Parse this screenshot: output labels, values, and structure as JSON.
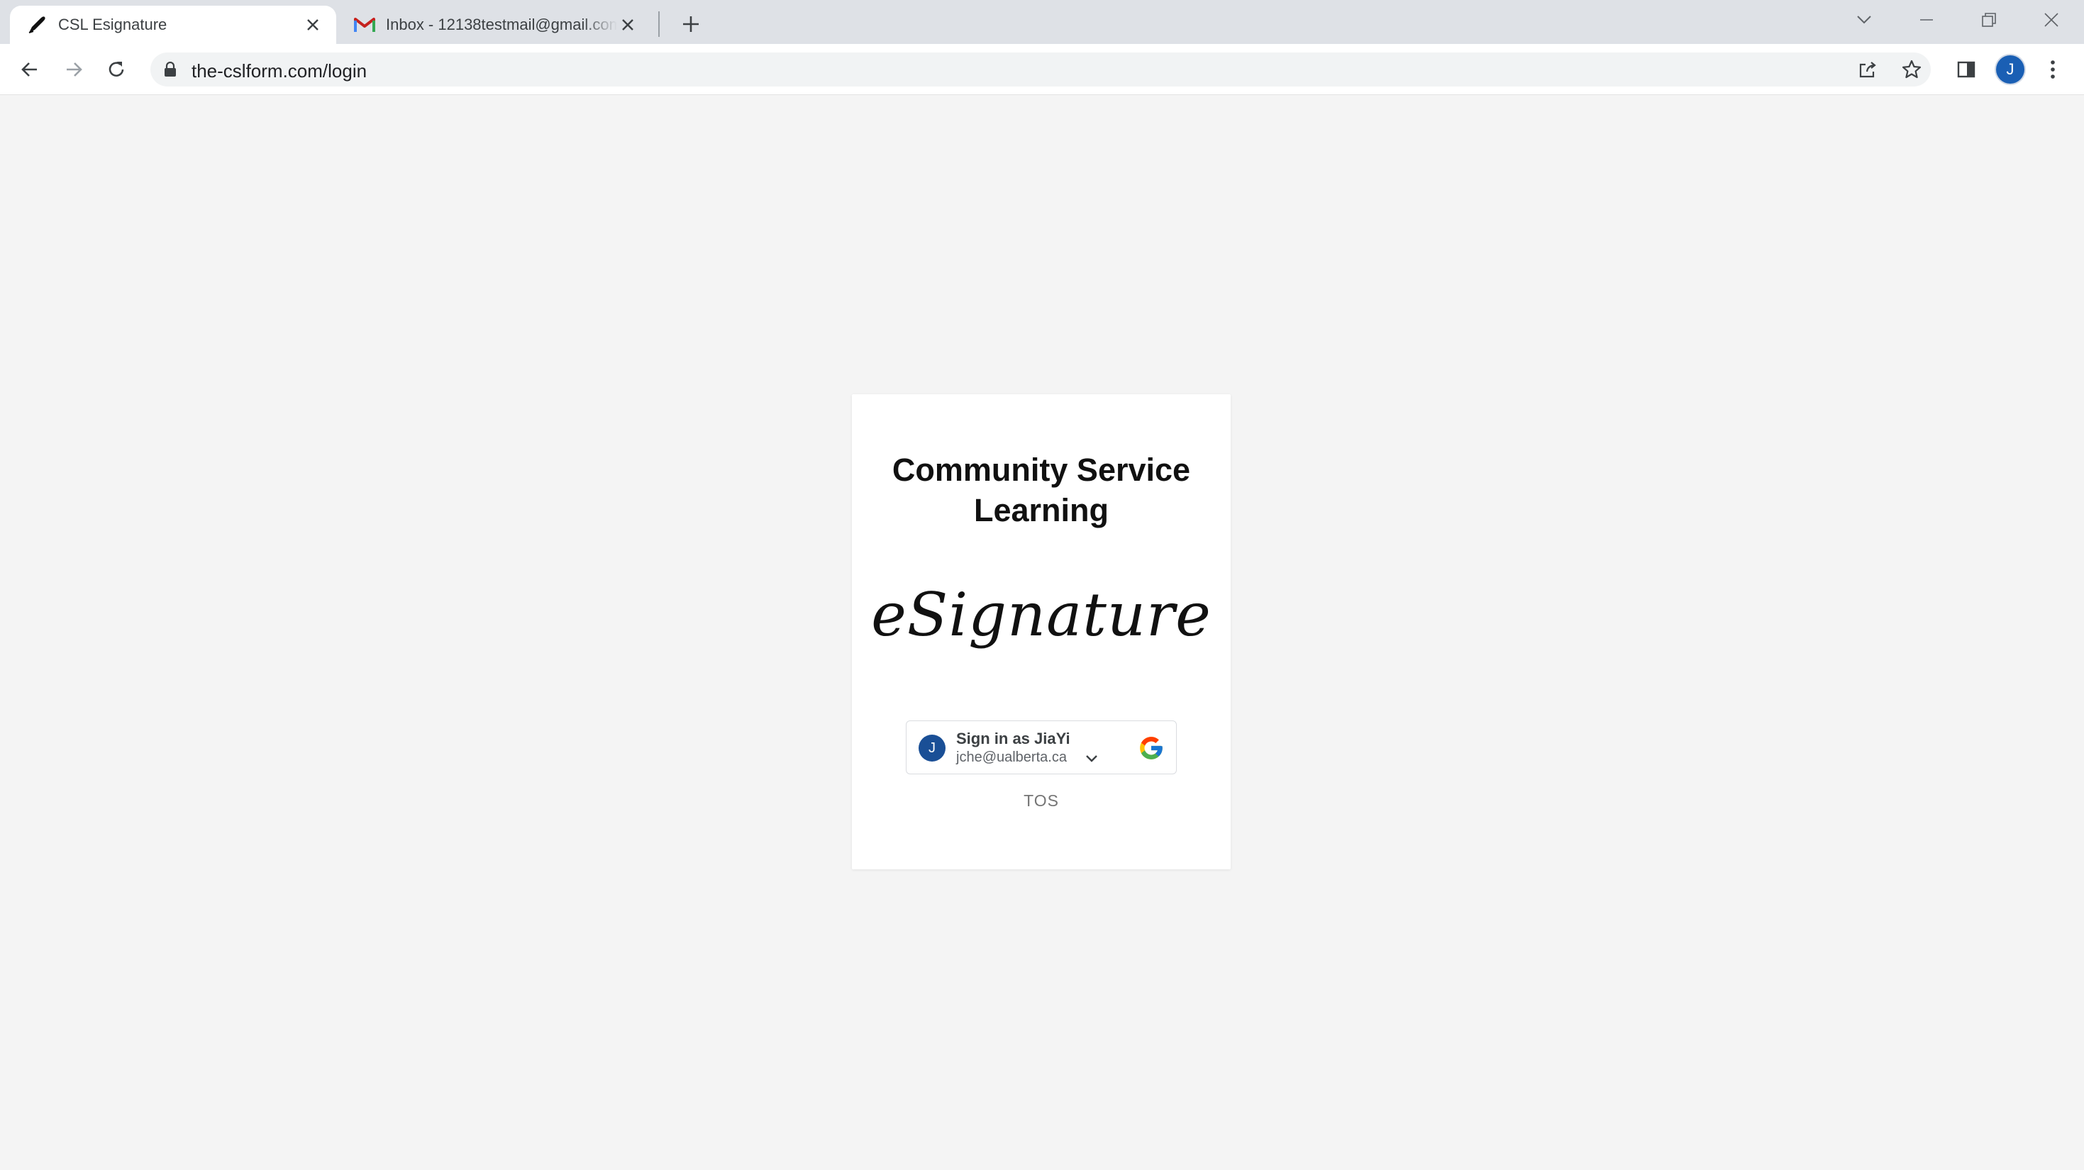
{
  "browser": {
    "tabs": [
      {
        "title": "CSL Esignature",
        "favicon": "pen-nib-icon",
        "active": true
      },
      {
        "title": "Inbox - 12138testmail@gmail.com",
        "favicon": "gmail-icon",
        "active": false
      }
    ],
    "url": "the-cslform.com/login",
    "profile_initial": "J"
  },
  "login": {
    "title_line1": "Community Service",
    "title_line2": "Learning",
    "logo_text": "eSignature",
    "google_signin": {
      "avatar_initial": "J",
      "label": "Sign in as JiaYi",
      "email": "jche@ualberta.ca"
    },
    "tos_label": "TOS"
  },
  "colors": {
    "page_background": "#f4f4f4",
    "card_background": "#ffffff",
    "avatar_blue": "#1a5fb4"
  }
}
